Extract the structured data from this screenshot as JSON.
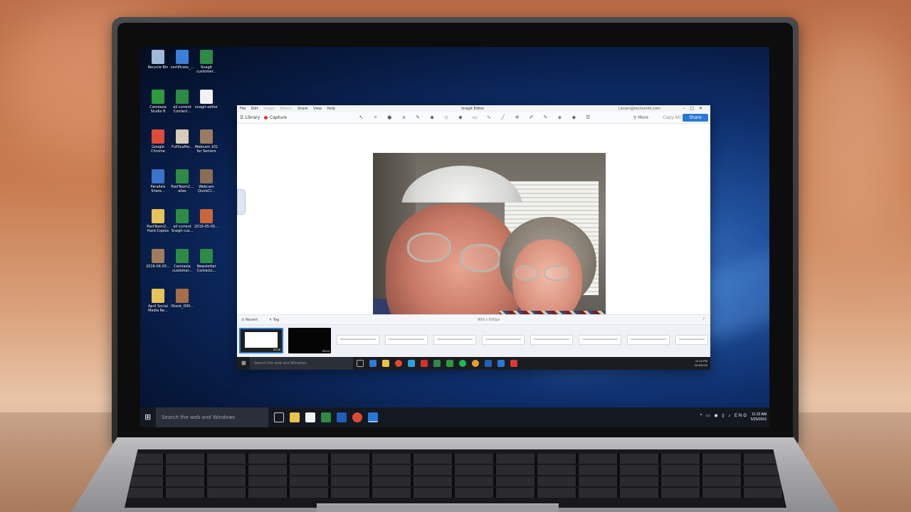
{
  "desktop": {
    "icons": [
      {
        "label": "Recycle Bin",
        "color": "#9fb9d8"
      },
      {
        "label": "certificate_...",
        "color": "#3c7fd6"
      },
      {
        "label": "Snagit customer...",
        "color": "#2e8b45"
      },
      {
        "label": "Camtasia Studio 8",
        "color": "#2e9a3f"
      },
      {
        "label": "all current Contact...",
        "color": "#2e8b45"
      },
      {
        "label": "snagit-editor",
        "color": "#f1f1f1"
      },
      {
        "label": "Google Chrome",
        "color": "#dd4b39"
      },
      {
        "label": "FullScaPer...",
        "color": "#d8cbb8"
      },
      {
        "label": "Webcam 101 for Seniors",
        "color": "#9b7b62"
      },
      {
        "label": "Parallels Share...",
        "color": "#3a74c8"
      },
      {
        "label": "PastTeam2... alias",
        "color": "#2e8b45"
      },
      {
        "label": "Webcam QuickCl...",
        "color": "#8a6d55"
      },
      {
        "label": "PastTeam2... Hard Copies",
        "color": "#e6c25a"
      },
      {
        "label": "all current Snagit cus...",
        "color": "#2e8b45"
      },
      {
        "label": "2016-05-05...",
        "color": "#c8673c"
      },
      {
        "label": "2016-04-05...",
        "color": "#a27c5e"
      },
      {
        "label": "Camtasia customer...",
        "color": "#2e8b45"
      },
      {
        "label": "Newsletter Contacts...",
        "color": "#2e8b45"
      },
      {
        "label": "April Social Media Re...",
        "color": "#e6c25a"
      },
      {
        "label": "iStock_000...",
        "color": "#a66f4a"
      }
    ],
    "taskbar": {
      "search_placeholder": "Search the web and Windows",
      "clock_time": "11:32 AM",
      "clock_date": "5/25/2016",
      "tray_lang": "ENG"
    }
  },
  "snagit": {
    "window_title": "Snagit Editor",
    "menu": [
      "File",
      "Edit",
      "Image",
      "Effects",
      "Share",
      "View",
      "Help"
    ],
    "account": "j.arsen@techsmith.com",
    "library_label": "Library",
    "capture_label": "Capture",
    "more_label": "More",
    "copy_all_label": "Copy All",
    "share_label": "Share",
    "tray": {
      "recent_label": "Recent",
      "tag_label": "Tag",
      "size_label": "800 x 600px"
    },
    "thumb_times": [
      "00:28",
      "00:14"
    ],
    "inner_taskbar": {
      "search_placeholder": "Search the web and Windows",
      "clock_time": "12:16 PM",
      "clock_date": "5/19/2016"
    }
  }
}
